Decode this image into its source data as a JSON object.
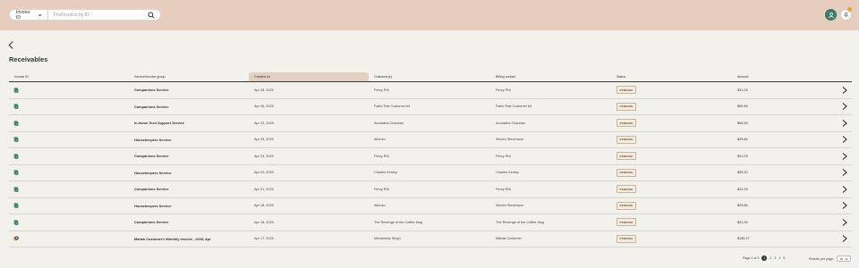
{
  "header": {
    "filter_select_label": "Invoice ID",
    "search_placeholder": "Find invoice by ID"
  },
  "page": {
    "title": "Receivables"
  },
  "table": {
    "columns": [
      "Invoice ID",
      "Service/Invoice group",
      "Created on",
      "Customer(s)",
      "Billing contact",
      "Status",
      "Amount"
    ],
    "rows": [
      {
        "icon": "invoice-green-icon",
        "group": "Companions Service",
        "created": "Apr 28, 2025",
        "customer": "Percy PIA",
        "billing": "Percy PIA",
        "status": "PENDING",
        "amount": "$31.03"
      },
      {
        "icon": "invoice-green-icon",
        "group": "Companions Service",
        "created": "Apr 26, 2025",
        "customer": "Fabio Test Customer #4",
        "billing": "Fabio Test Customer #4",
        "status": "PENDING",
        "amount": "$50.45"
      },
      {
        "icon": "invoice-green-icon",
        "group": "In-home Tech Support  Service",
        "created": "Apr 23, 2025",
        "customer": "Anuradha Chauhan",
        "billing": "Anuradha Chauhan",
        "status": "PENDING",
        "amount": "$65.53"
      },
      {
        "icon": "invoice-green-icon",
        "group": "Housekeepers Service",
        "created": "Apr 23, 2025",
        "customer": "Alfonso",
        "billing": "Steven Stevenson",
        "status": "PENDING",
        "amount": "$29.66"
      },
      {
        "icon": "invoice-green-icon",
        "group": "Companions Service",
        "created": "Apr 23, 2025",
        "customer": "Percy PIA",
        "billing": "Percy PIA",
        "status": "PENDING",
        "amount": "$31.03"
      },
      {
        "icon": "invoice-green-icon",
        "group": "Housekeepers Service",
        "created": "Apr 23, 2025",
        "customer": "Charles Kenley",
        "billing": "Charles Kenley",
        "status": "PENDING",
        "amount": "$35.20"
      },
      {
        "icon": "invoice-green-icon",
        "group": "Companions Service",
        "created": "Apr 21, 2025",
        "customer": "Percy PIA",
        "billing": "Percy PIA",
        "status": "PENDING",
        "amount": "$31.03"
      },
      {
        "icon": "invoice-green-icon",
        "group": "Housekeepers Service",
        "created": "Apr 18, 2025",
        "customer": "Alfonso",
        "billing": "Steven Stevenson",
        "status": "PENDING",
        "amount": "$29.66"
      },
      {
        "icon": "invoice-green-icon",
        "group": "Companions Service",
        "created": "Apr 18, 2025",
        "customer": "The Revenge of the Coffee Mug",
        "billing": "The Revenge of the Coffee Mug",
        "status": "PENDING",
        "amount": "$31.03"
      },
      {
        "icon": "invoice-orange-icon",
        "group": "Mahak Customer's Monthly Invoice - 2025, Apr",
        "created": "Apr 17, 2025",
        "customer": "Mohaldeep Singh",
        "billing": "Mahak Customer",
        "status": "PENDING",
        "amount": "$185.27"
      }
    ]
  },
  "pagination": {
    "page_of": "Page 1 of 9",
    "pages": [
      "1",
      "2",
      "3",
      "4",
      "5"
    ],
    "results_label": "Results per page:",
    "per_page_value": "10"
  },
  "colors": {
    "header_bg": "#e6cdbd",
    "page_bg": "#f2f1ec",
    "avatar_green": "#3c7a63",
    "notification_dot": "#e8a030",
    "sorted_col_bg": "#e3cfc1"
  }
}
